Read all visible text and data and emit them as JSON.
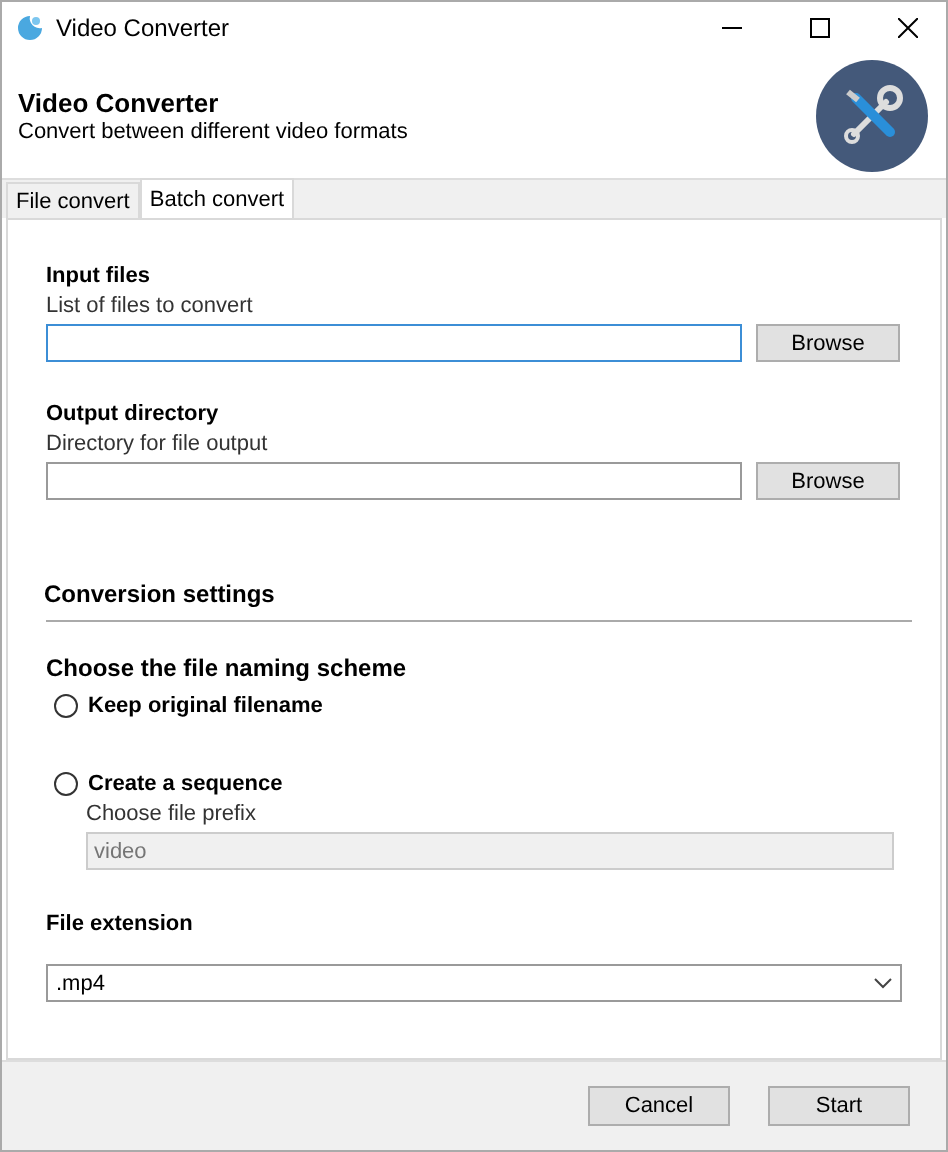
{
  "window": {
    "title": "Video Converter"
  },
  "header": {
    "title": "Video Converter",
    "subtitle": "Convert between different video formats"
  },
  "tabs": [
    {
      "label": "File convert",
      "selected": false
    },
    {
      "label": "Batch convert",
      "selected": true
    }
  ],
  "input_files": {
    "label": "Input files",
    "description": "List of files to convert",
    "focused": true,
    "button": "Browse"
  },
  "output_directory": {
    "label": "Output directory",
    "description": "Directory for file output",
    "focused": false,
    "button": "Browse"
  },
  "conversion_settings": {
    "heading": "Conversion settings",
    "naming_label": "Choose the file naming scheme",
    "options": [
      {
        "label": "Keep original filename",
        "selected": false
      },
      {
        "label": "Create a sequence",
        "selected": false
      }
    ],
    "prefix": {
      "label": "Choose file prefix",
      "placeholder": "video",
      "disabled": true
    },
    "extension_label": "File extension",
    "extension": ".mp4"
  },
  "buttons": [
    "Cancel",
    "Start"
  ]
}
